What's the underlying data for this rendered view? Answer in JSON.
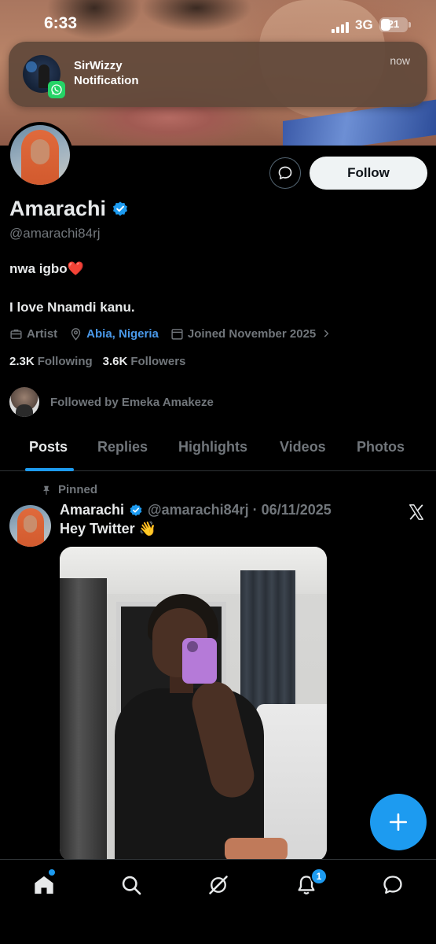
{
  "status_bar": {
    "time": "6:33",
    "network": "3G",
    "battery": "21"
  },
  "notification": {
    "sender": "SirWizzy",
    "body": "Notification",
    "time": "now",
    "app_icon": "whatsapp-icon"
  },
  "profile": {
    "display_name": "Amarachi",
    "handle": "@amarachi84rj",
    "follow_label": "Follow",
    "bio_line1": "nwa igbo❤️",
    "bio_line2": "I love Nnamdi kanu.",
    "category": "Artist",
    "location": "Abia, Nigeria",
    "joined": "Joined November 2025",
    "following_count": "2.3K",
    "following_label": "Following",
    "followers_count": "3.6K",
    "followers_label": "Followers",
    "followed_by": "Followed by Emeka Amakeze"
  },
  "tabs": [
    "Posts",
    "Replies",
    "Highlights",
    "Videos",
    "Photos"
  ],
  "post": {
    "pinned_label": "Pinned",
    "author": "Amarachi",
    "handle_date": "@amarachi84rj · 06/11/2025",
    "text": "Hey Twitter 👋"
  },
  "nav": {
    "notification_badge": "1"
  },
  "colors": {
    "accent": "#1d9bf0",
    "link": "#4a99e9",
    "background": "#000000"
  }
}
